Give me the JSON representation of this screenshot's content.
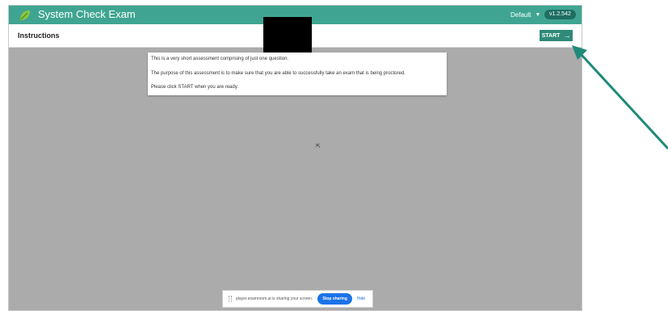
{
  "appbar": {
    "title": "System Check Exam",
    "profile_label": "Default",
    "version": "v1.2.542"
  },
  "toolbar": {
    "title": "Instructions",
    "start_label": "START"
  },
  "instructions": {
    "line1": "This is a very short assessment comprising of just one question.",
    "line2": "The purpose of this assessment is to make sure that you are able to successfully take an exam that is being proctored.",
    "line3": "Please click START when you are ready."
  },
  "share_bar": {
    "message": "player.examroom.ai is sharing your screen.",
    "stop_label": "Stop sharing",
    "hide_label": "Hide"
  },
  "colors": {
    "appbar": "#3fa592",
    "start_button": "#2f8a78",
    "background": "#ababab",
    "stop_button": "#1a73e8",
    "annotation_arrow": "#1f8a78"
  },
  "icons": {
    "logo": "leaf-logo",
    "profile_caret": "caret-down-icon",
    "start_arrow": "arrow-right-icon",
    "cursor": "mouse-cursor-icon",
    "annotation": "annotation-arrow"
  }
}
